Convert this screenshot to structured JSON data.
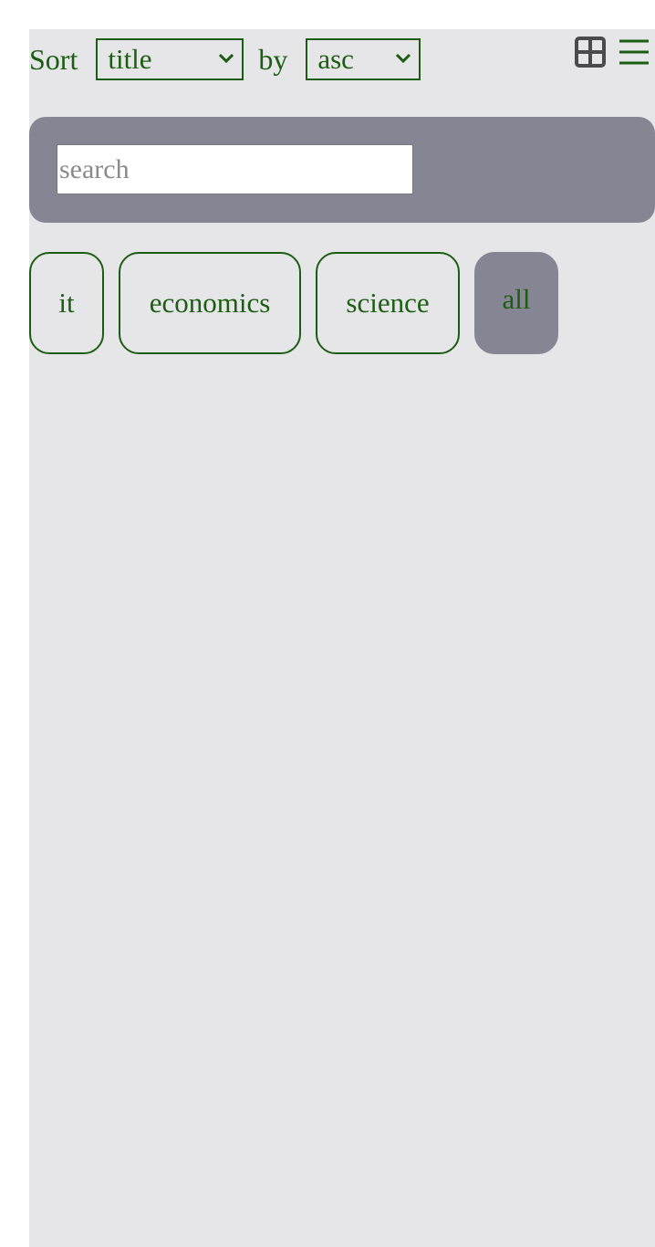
{
  "sort": {
    "label": "Sort",
    "field_value": "title",
    "by_label": "by",
    "order_value": "asc"
  },
  "view": {
    "grid_icon": "grid-view-icon",
    "list_icon": "list-view-icon"
  },
  "search": {
    "placeholder": "search",
    "value": ""
  },
  "tags": [
    {
      "label": "it"
    },
    {
      "label": "economics"
    },
    {
      "label": "science"
    },
    {
      "label": "all",
      "active": true
    }
  ],
  "colors": {
    "text_green": "#1b5e12",
    "panel_bg": "#e6e6e9",
    "accent_gray": "#858593"
  }
}
